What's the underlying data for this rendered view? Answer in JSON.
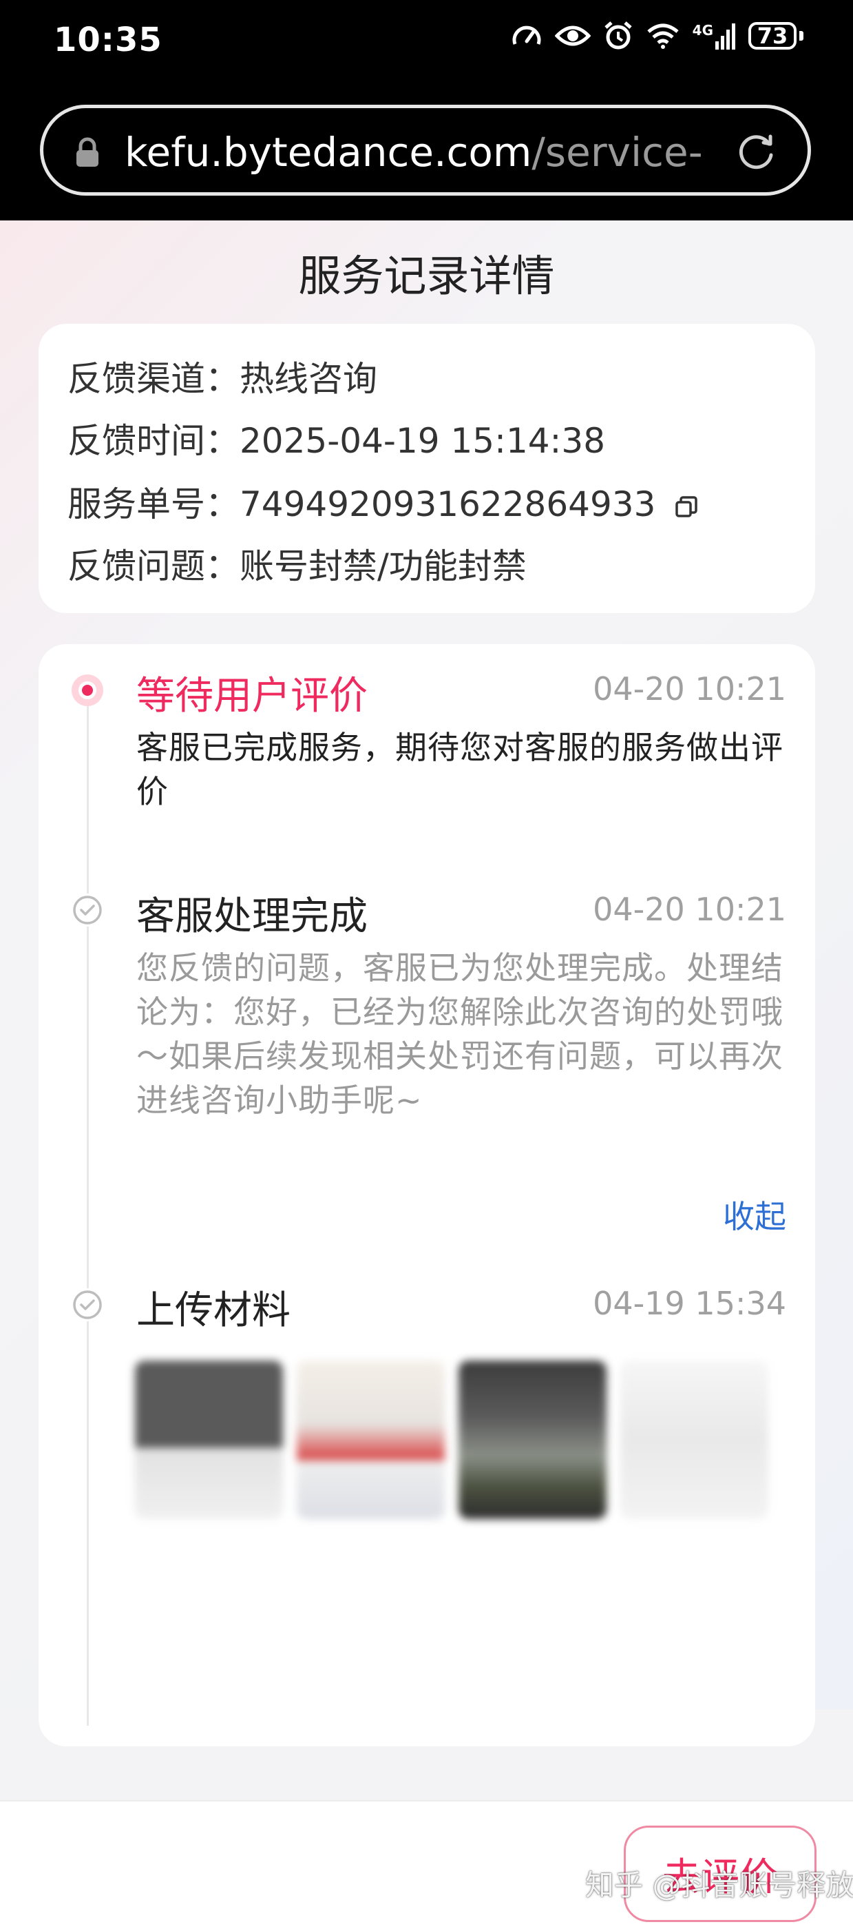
{
  "status_bar": {
    "time": "10:35",
    "battery": "73",
    "network": "4G"
  },
  "browser": {
    "url_host": "kefu.bytedance.com",
    "url_path": "/service-"
  },
  "page": {
    "title": "服务记录详情"
  },
  "info": {
    "channel_label": "反馈渠道：",
    "channel_value": "热线咨询",
    "time_label": "反馈时间：",
    "time_value": "2025-04-19 15:14:38",
    "order_label": "服务单号：",
    "order_value": "7494920931622864933",
    "issue_label": "反馈问题：",
    "issue_value": "账号封禁/功能封禁"
  },
  "timeline": [
    {
      "title": "等待用户评价",
      "time": "04-20 10:21",
      "desc": "客服已完成服务，期待您对客服的服务做出评价"
    },
    {
      "title": "客服处理完成",
      "time": "04-20 10:21",
      "desc": "您反馈的问题，客服已为您处理完成。处理结论为：您好，已经为您解除此次咨询的处罚哦～如果后续发现相关处罚还有问题，可以再次进线咨询小助手呢~"
    },
    {
      "title": "上传材料",
      "time": "04-19 15:34"
    }
  ],
  "collapse_label": "收起",
  "bottom": {
    "rate_button": "去评价",
    "watermark": "知乎 @抖音账号释放"
  },
  "colors": {
    "accent": "#ee2a5f",
    "link": "#2e6fd6",
    "muted": "#a0a0a0"
  }
}
